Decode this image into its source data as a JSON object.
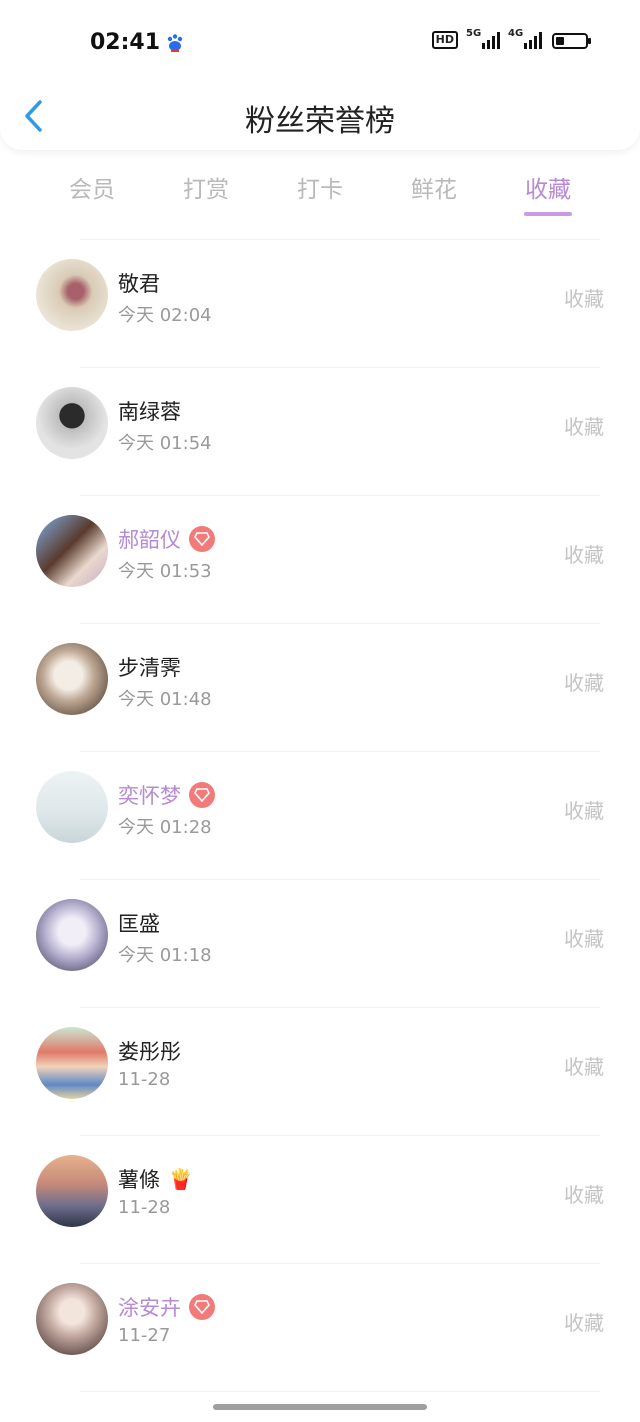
{
  "status_bar": {
    "time": "02:41",
    "hd_label": "HD",
    "net1": "5G",
    "net2": "4G",
    "battery_level": 0.3
  },
  "nav": {
    "title": "粉丝荣誉榜"
  },
  "tabs": [
    {
      "label": "会员",
      "active": false
    },
    {
      "label": "打赏",
      "active": false
    },
    {
      "label": "打卡",
      "active": false
    },
    {
      "label": "鲜花",
      "active": false
    },
    {
      "label": "收藏",
      "active": true
    }
  ],
  "rows": [
    {
      "name": "敬君",
      "time": "今天 02:04",
      "action": "收藏",
      "vip": false
    },
    {
      "name": "南绿蓉",
      "time": "今天 01:54",
      "action": "收藏",
      "vip": false
    },
    {
      "name": "郝韶仪",
      "time": "今天 01:53",
      "action": "收藏",
      "vip": true
    },
    {
      "name": "步清霁",
      "time": "今天 01:48",
      "action": "收藏",
      "vip": false
    },
    {
      "name": "奕怀梦",
      "time": "今天 01:28",
      "action": "收藏",
      "vip": true
    },
    {
      "name": "匡盛",
      "time": "今天 01:18",
      "action": "收藏",
      "vip": false
    },
    {
      "name": "娄彤彤",
      "time": "11-28",
      "action": "收藏",
      "vip": false
    },
    {
      "name": "薯條",
      "emoji": "🍟",
      "time": "11-28",
      "action": "收藏",
      "vip": false
    },
    {
      "name": "涂安卉",
      "time": "11-27",
      "action": "收藏",
      "vip": true
    }
  ],
  "colors": {
    "accent": "#b58ad6",
    "badge": "#f27a78",
    "muted": "#c4c4c4"
  }
}
